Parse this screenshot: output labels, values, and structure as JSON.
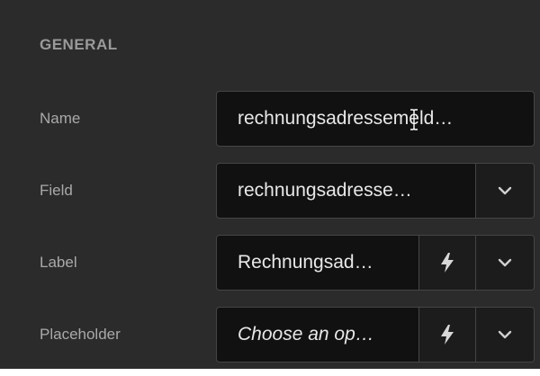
{
  "section": {
    "title": "GENERAL"
  },
  "rows": [
    {
      "label": "Name",
      "value": "rechnungsadressemeld…"
    },
    {
      "label": "Field",
      "value": "rechnungsadresse…"
    },
    {
      "label": "Label",
      "value": "Rechnungsad…"
    },
    {
      "label": "Placeholder",
      "value": "Choose an op…"
    }
  ],
  "icons": {
    "dynamic": "lightning-bolt-icon",
    "dropdown": "chevron-down-icon",
    "cursor": "text-cursor-icon"
  },
  "colors": {
    "panel_bg": "#2b2b2b",
    "input_bg": "#111111",
    "border": "#454545",
    "text": "#e8e8e8",
    "label": "#a9a9a9"
  }
}
